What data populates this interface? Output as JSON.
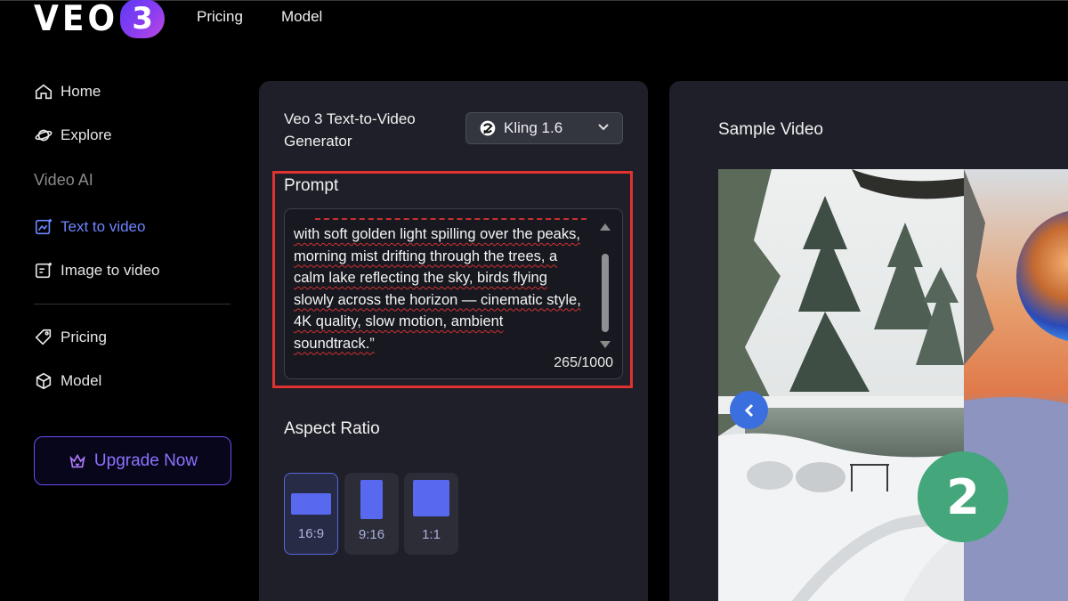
{
  "header": {
    "logo_text": "VEO",
    "logo_badge": "3",
    "nav": [
      "Pricing",
      "Model"
    ]
  },
  "sidebar": {
    "items": [
      {
        "label": "Home",
        "icon": "home-icon"
      },
      {
        "label": "Explore",
        "icon": "planet-icon"
      }
    ],
    "section_title": "Video AI",
    "video_items": [
      {
        "label": "Text to video",
        "icon": "text-video-icon",
        "active": true
      },
      {
        "label": "Image to video",
        "icon": "image-video-icon",
        "active": false
      }
    ],
    "bottom_items": [
      {
        "label": "Pricing",
        "icon": "tag-icon"
      },
      {
        "label": "Model",
        "icon": "cube-icon"
      }
    ],
    "upgrade_label": "Upgrade Now"
  },
  "generator": {
    "title": "Veo 3 Text-to-Video Generator",
    "model_value": "Kling 1.6",
    "prompt_label": "Prompt",
    "prompt_text": "with soft golden light spilling over the peaks, morning mist drifting through the trees, a calm lake reflecting the sky, birds flying slowly across the horizon — cinematic style, 4K quality, slow motion, ambient soundtrack.”",
    "char_count": "265/1000",
    "aspect_label": "Aspect Ratio",
    "aspect_options": [
      {
        "label": "16:9",
        "selected": true
      },
      {
        "label": "9:16",
        "selected": false
      },
      {
        "label": "1:1",
        "selected": false
      }
    ]
  },
  "sample": {
    "title": "Sample Video"
  },
  "step_badge": "2",
  "colors": {
    "accent": "#5869f0",
    "highlight": "#e0322f",
    "badge": "#44a67b",
    "upgrade": "#8e72ff"
  }
}
